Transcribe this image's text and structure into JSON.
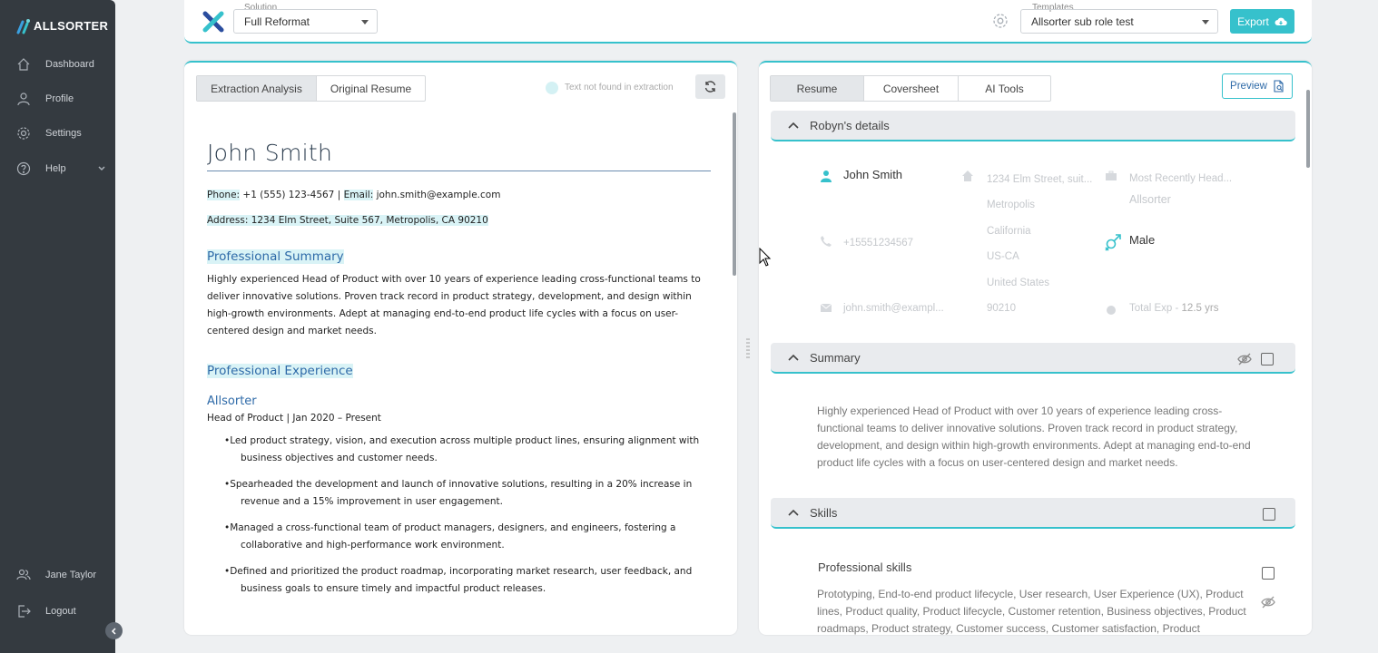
{
  "sidebar": {
    "brand": "ALLSORTER",
    "items": [
      {
        "label": "Dashboard",
        "icon": "home-icon"
      },
      {
        "label": "Profile",
        "icon": "user-icon"
      },
      {
        "label": "Settings",
        "icon": "gear-icon"
      },
      {
        "label": "Help",
        "icon": "help-icon"
      }
    ],
    "user": "Jane Taylor",
    "logout": "Logout"
  },
  "topbar": {
    "solution_label": "Solution",
    "solution_value": "Full Reformat",
    "templates_label": "Templates",
    "templates_value": "Allsorter sub role test",
    "export_label": "Export"
  },
  "left_panel": {
    "tabs": [
      "Extraction Analysis",
      "Original Resume"
    ],
    "active_tab": 0,
    "legend": "Text not found in extraction",
    "resume": {
      "name": "John Smith",
      "phone_label": "Phone:",
      "phone_value": " +1 (555) 123-4567",
      "sep": " | ",
      "email_label": "Email:",
      "email_value": " john.smith@example.com",
      "address": "Address: 1234 Elm Street, Suite 567, Metropolis, CA 90210",
      "summary_title": "Professional Summary",
      "summary": "Highly experienced Head of Product with over 10 years of experience leading cross-functional teams to deliver innovative solutions. Proven track record in product strategy, development, and design within high-growth environments. Adept at managing end-to-end product life cycles with a focus on user-centered design and market needs.",
      "experience_title": "Professional Experience",
      "company": "Allsorter",
      "role": "Head of Product | Jan 2020 – Present",
      "bullets": [
        "•Led product strategy, vision, and execution across multiple product lines, ensuring alignment with business objectives and customer needs.",
        "•Spearheaded the development and launch of innovative solutions, resulting in a 20% increase in revenue and a 15% improvement in user engagement.",
        "•Managed a cross-functional team of product managers, designers, and engineers, fostering a collaborative and high-performance work environment.",
        "•Defined and prioritized the product roadmap, incorporating market research, user feedback, and business goals to ensure timely and impactful product releases."
      ]
    }
  },
  "right_panel": {
    "tabs": [
      "Resume",
      "Coversheet",
      "AI Tools"
    ],
    "active_tab": 0,
    "preview_label": "Preview",
    "details": {
      "title": "Robyn's details",
      "name": "John Smith",
      "phone": "+15551234567",
      "email": "john.smith@exampl...",
      "address_lines": [
        "1234 Elm Street, suit...",
        "Metropolis",
        "California",
        "US-CA",
        "United States",
        "90210"
      ],
      "headline_label": "Most Recently Head...",
      "headline_company": "Allsorter",
      "gender": "Male",
      "total_exp": "Total Exp - ",
      "total_exp_value": "12.5 yrs"
    },
    "summary": {
      "title": "Summary",
      "text": "Highly experienced Head of Product with over 10 years of experience leading cross-functional teams to deliver innovative solutions. Proven track record in product strategy, development, and design within high-growth environments. Adept at managing end-to-end product life cycles with a focus on user-centered design and market needs."
    },
    "skills": {
      "title": "Skills",
      "sub_title": "Professional skills",
      "text": "Prototyping, End-to-end product lifecycle, User research, User Experience (UX), Product lines, Product quality, Product lifecycle, Customer retention, Business objectives, Product roadmaps, Product strategy, Customer success, Customer satisfaction, Product"
    }
  },
  "colors": {
    "accent": "#36c1cc",
    "sidebar_bg": "#343a40",
    "highlight": "#d9f3f6",
    "heading_blue": "#2e6aa8"
  }
}
